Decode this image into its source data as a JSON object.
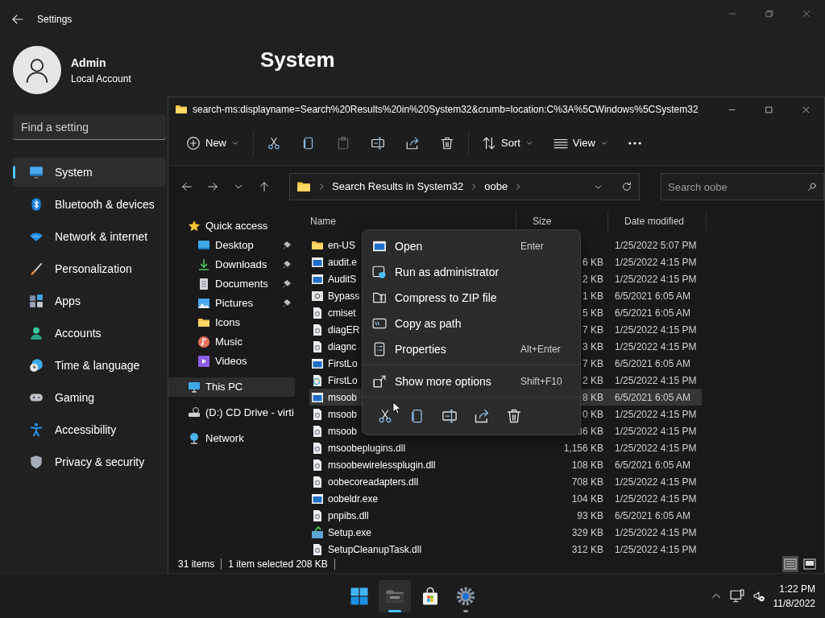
{
  "settings": {
    "title": "Settings",
    "user": {
      "name": "Admin",
      "account": "Local Account"
    },
    "heading": "System",
    "search": {
      "placeholder": "Find a setting"
    },
    "nav": [
      {
        "label": "System",
        "kind": "system",
        "selected": true
      },
      {
        "label": "Bluetooth & devices",
        "kind": "bluetooth",
        "selected": false
      },
      {
        "label": "Network & internet",
        "kind": "network",
        "selected": false
      },
      {
        "label": "Personalization",
        "kind": "personalization",
        "selected": false
      },
      {
        "label": "Apps",
        "kind": "apps",
        "selected": false
      },
      {
        "label": "Accounts",
        "kind": "accounts",
        "selected": false
      },
      {
        "label": "Time & language",
        "kind": "time",
        "selected": false
      },
      {
        "label": "Gaming",
        "kind": "gaming",
        "selected": false
      },
      {
        "label": "Accessibility",
        "kind": "accessibility",
        "selected": false
      },
      {
        "label": "Privacy & security",
        "kind": "privacy",
        "selected": false
      }
    ]
  },
  "explorer": {
    "title": "search-ms:displayname=Search%20Results%20in%20System32&crumb=location:C%3A%5CWindows%5CSystem32",
    "toolbar": [
      {
        "kind": "new",
        "label": "New",
        "disabled": false
      },
      {
        "kind": "cut",
        "disabled": false
      },
      {
        "kind": "copy",
        "disabled": false
      },
      {
        "kind": "paste",
        "disabled": true
      },
      {
        "kind": "rename",
        "disabled": false
      },
      {
        "kind": "share",
        "disabled": false
      },
      {
        "kind": "delete",
        "disabled": false
      },
      {
        "kind": "sort",
        "label": "Sort",
        "disabled": false
      },
      {
        "kind": "view",
        "label": "View",
        "disabled": false
      },
      {
        "kind": "more",
        "disabled": false
      }
    ],
    "breadcrumb": [
      "Search Results in System32",
      "oobe"
    ],
    "search": {
      "placeholder": "Search oobe"
    },
    "tree": [
      {
        "label": "Quick access",
        "kind": "star",
        "selected": false,
        "children": [
          {
            "label": "Desktop",
            "kind": "desktop",
            "pinned": true,
            "selected": false
          },
          {
            "label": "Downloads",
            "kind": "downloads",
            "pinned": true,
            "selected": false
          },
          {
            "label": "Documents",
            "kind": "documents",
            "pinned": true,
            "selected": false
          },
          {
            "label": "Pictures",
            "kind": "pictures",
            "pinned": true,
            "selected": false
          },
          {
            "label": "Icons",
            "kind": "folder",
            "pinned": false,
            "selected": false
          },
          {
            "label": "Music",
            "kind": "music",
            "pinned": false,
            "selected": false
          },
          {
            "label": "Videos",
            "kind": "videos",
            "pinned": false,
            "selected": false
          }
        ]
      },
      {
        "label": "This PC",
        "kind": "pc",
        "selected": true
      },
      {
        "label": "(D:) CD Drive - virti",
        "kind": "drive",
        "selected": false
      },
      {
        "label": "Network",
        "kind": "network",
        "selected": false
      }
    ],
    "columns": [
      "Name",
      "Size",
      "Date modified"
    ],
    "rows": [
      {
        "name": "en-US",
        "kind": "folder",
        "size": "",
        "date": "1/25/2022 5:07 PM",
        "selected": false
      },
      {
        "name": "audit.e",
        "kind": "exe",
        "size": "6 KB",
        "date": "1/25/2022 4:15 PM",
        "selected": false
      },
      {
        "name": "AuditS",
        "kind": "exe",
        "size": "2 KB",
        "date": "1/25/2022 4:15 PM",
        "selected": false
      },
      {
        "name": "Bypass",
        "kind": "tool",
        "size": "1 KB",
        "date": "6/5/2021 6:05 AM",
        "selected": false
      },
      {
        "name": "cmiset",
        "kind": "dll",
        "size": "5 KB",
        "date": "6/5/2021 6:05 AM",
        "selected": false
      },
      {
        "name": "diagER",
        "kind": "dll",
        "size": "7 KB",
        "date": "1/25/2022 4:15 PM",
        "selected": false
      },
      {
        "name": "diagnc",
        "kind": "dll",
        "size": "3 KB",
        "date": "1/25/2022 4:15 PM",
        "selected": false
      },
      {
        "name": "FirstLo",
        "kind": "exe",
        "size": "7 KB",
        "date": "6/5/2021 6:05 AM",
        "selected": false
      },
      {
        "name": "FirstLo",
        "kind": "web",
        "size": "2 KB",
        "date": "1/25/2022 4:15 PM",
        "selected": false
      },
      {
        "name": "msoob",
        "kind": "exe",
        "size": "8 KB",
        "date": "6/5/2021 6:05 AM",
        "selected": true
      },
      {
        "name": "msoob",
        "kind": "dll",
        "size": "0 KB",
        "date": "1/25/2022 4:15 PM",
        "selected": false
      },
      {
        "name": "msoob",
        "kind": "dll",
        "size": "36 KB",
        "date": "1/25/2022 4:15 PM",
        "selected": false
      },
      {
        "name": "msoobeplugins.dll",
        "kind": "dll",
        "size": "1,156 KB",
        "date": "1/25/2022 4:15 PM",
        "selected": false
      },
      {
        "name": "msoobewirelessplugin.dll",
        "kind": "dll",
        "size": "108 KB",
        "date": "6/5/2021 6:05 AM",
        "selected": false
      },
      {
        "name": "oobecoreadapters.dll",
        "kind": "dll",
        "size": "708 KB",
        "date": "1/25/2022 4:15 PM",
        "selected": false
      },
      {
        "name": "oobeldr.exe",
        "kind": "exe",
        "size": "104 KB",
        "date": "1/25/2022 4:15 PM",
        "selected": false
      },
      {
        "name": "pnpibs.dll",
        "kind": "dll",
        "size": "93 KB",
        "date": "6/5/2021 6:05 AM",
        "selected": false
      },
      {
        "name": "Setup.exe",
        "kind": "setup",
        "size": "329 KB",
        "date": "1/25/2022 4:15 PM",
        "selected": false
      },
      {
        "name": "SetupCleanupTask.dll",
        "kind": "dll",
        "size": "312 KB",
        "date": "1/25/2022 4:15 PM",
        "selected": false
      }
    ],
    "status": {
      "count": "31 items",
      "selection": "1 item selected  208 KB"
    },
    "views": [
      {
        "kind": "details",
        "selected": true
      },
      {
        "kind": "tiles",
        "selected": false
      }
    ]
  },
  "context_menu": {
    "items": [
      {
        "label": "Open",
        "kind": "open",
        "shortcut": "Enter"
      },
      {
        "label": "Run as administrator",
        "kind": "admin"
      },
      {
        "label": "Compress to ZIP file",
        "kind": "zip"
      },
      {
        "label": "Copy as path",
        "kind": "path"
      },
      {
        "label": "Properties",
        "kind": "properties",
        "shortcut": "Alt+Enter"
      },
      {
        "label": "Show more options",
        "kind": "more",
        "shortcut": "Shift+F10"
      }
    ],
    "actions": [
      {
        "kind": "cut"
      },
      {
        "kind": "copy"
      },
      {
        "kind": "rename"
      },
      {
        "kind": "share"
      },
      {
        "kind": "delete"
      }
    ]
  },
  "taskbar": {
    "apps": [
      {
        "kind": "start",
        "active": false,
        "running": false
      },
      {
        "kind": "explorer",
        "active": true,
        "running": true
      },
      {
        "kind": "store",
        "active": false,
        "running": false
      },
      {
        "kind": "settings",
        "active": false,
        "running": true
      }
    ],
    "time": "1:22 PM",
    "date": "11/8/2022"
  }
}
